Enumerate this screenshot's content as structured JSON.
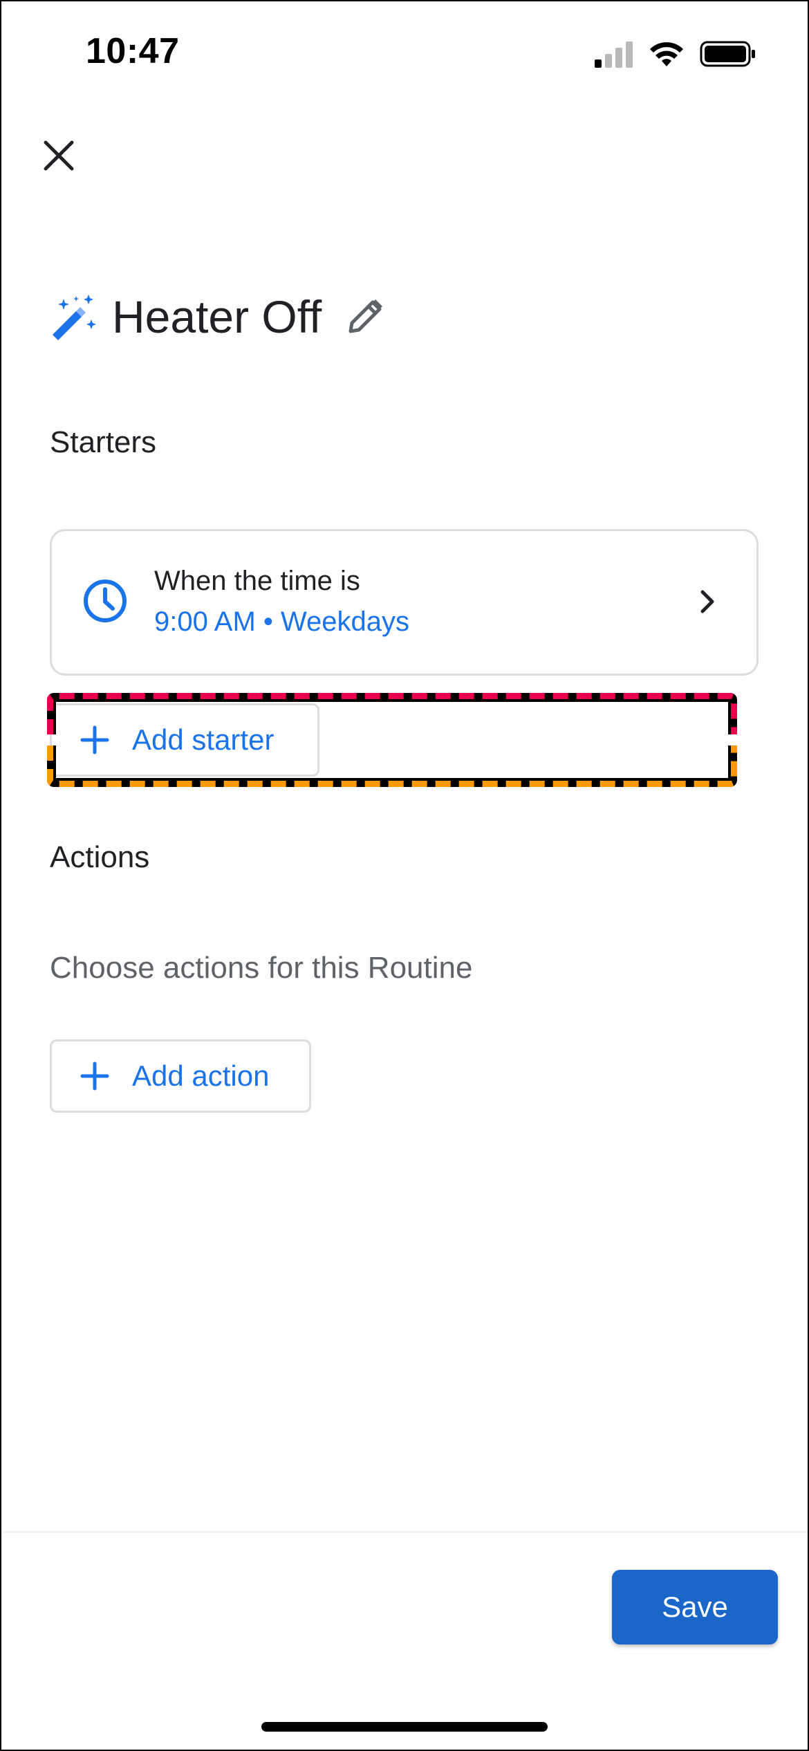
{
  "status_bar": {
    "time": "10:47"
  },
  "header": {
    "close_icon": "close-icon"
  },
  "routine": {
    "title": "Heater Off",
    "icon": "magic-wand-icon",
    "edit_icon": "pencil-icon"
  },
  "starters": {
    "label": "Starters",
    "items": [
      {
        "title": "When the time is",
        "subtitle": "9:00 AM • Weekdays",
        "icon": "clock-icon"
      }
    ],
    "add_label": "Add starter"
  },
  "actions": {
    "label": "Actions",
    "helper": "Choose actions for this Routine",
    "add_label": "Add action"
  },
  "footer": {
    "save_label": "Save"
  },
  "colors": {
    "accent": "#1a73e8",
    "save_button": "#1a66c9",
    "highlight_top": "#e8004c",
    "highlight_bottom": "#ff9900"
  }
}
